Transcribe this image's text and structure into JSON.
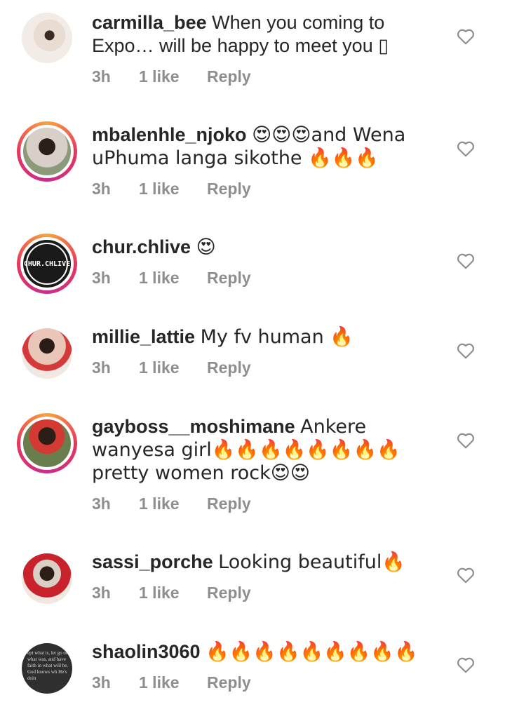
{
  "comments": [
    {
      "username": "carmilla_bee",
      "text": "When you coming to Expo… will be happy to meet you ",
      "time": "3h",
      "likes": "1 like",
      "reply": "Reply"
    },
    {
      "username": "mbalenhle_njoko",
      "text": "😍😍😍and Wena uPhuma langa sikothe 🔥🔥🔥",
      "time": "3h",
      "likes": "1 like",
      "reply": "Reply"
    },
    {
      "username": "chur.chlive",
      "text": "😍",
      "time": "3h",
      "likes": "1 like",
      "reply": "Reply",
      "avatar_text": "CHUR.CHLIVE"
    },
    {
      "username": "millie_lattie",
      "text": "My fv human 🔥",
      "time": "3h",
      "likes": "1 like",
      "reply": "Reply"
    },
    {
      "username": "gayboss__moshimane",
      "text": "Ankere wanyesa girl🔥🔥🔥🔥🔥🔥🔥🔥pretty women rock😍😍",
      "time": "3h",
      "likes": "1 like",
      "reply": "Reply"
    },
    {
      "username": "sassi_porche",
      "text": "Looking beautiful🔥",
      "time": "3h",
      "likes": "1 like",
      "reply": "Reply"
    },
    {
      "username": "shaolin3060",
      "text": "🔥🔥🔥🔥🔥🔥🔥🔥🔥",
      "time": "3h",
      "likes": "1 like",
      "reply": "Reply",
      "avatar_text": "ept what is, let go of what was, and have faith in what will be. God knows wh He's doin"
    }
  ],
  "icons": {
    "like": "heart-outline-icon"
  },
  "colors": {
    "text": "#262626",
    "meta": "#8e8e8e",
    "story_ring": [
      "#f9a23a",
      "#e8365d",
      "#c62d8c"
    ]
  }
}
